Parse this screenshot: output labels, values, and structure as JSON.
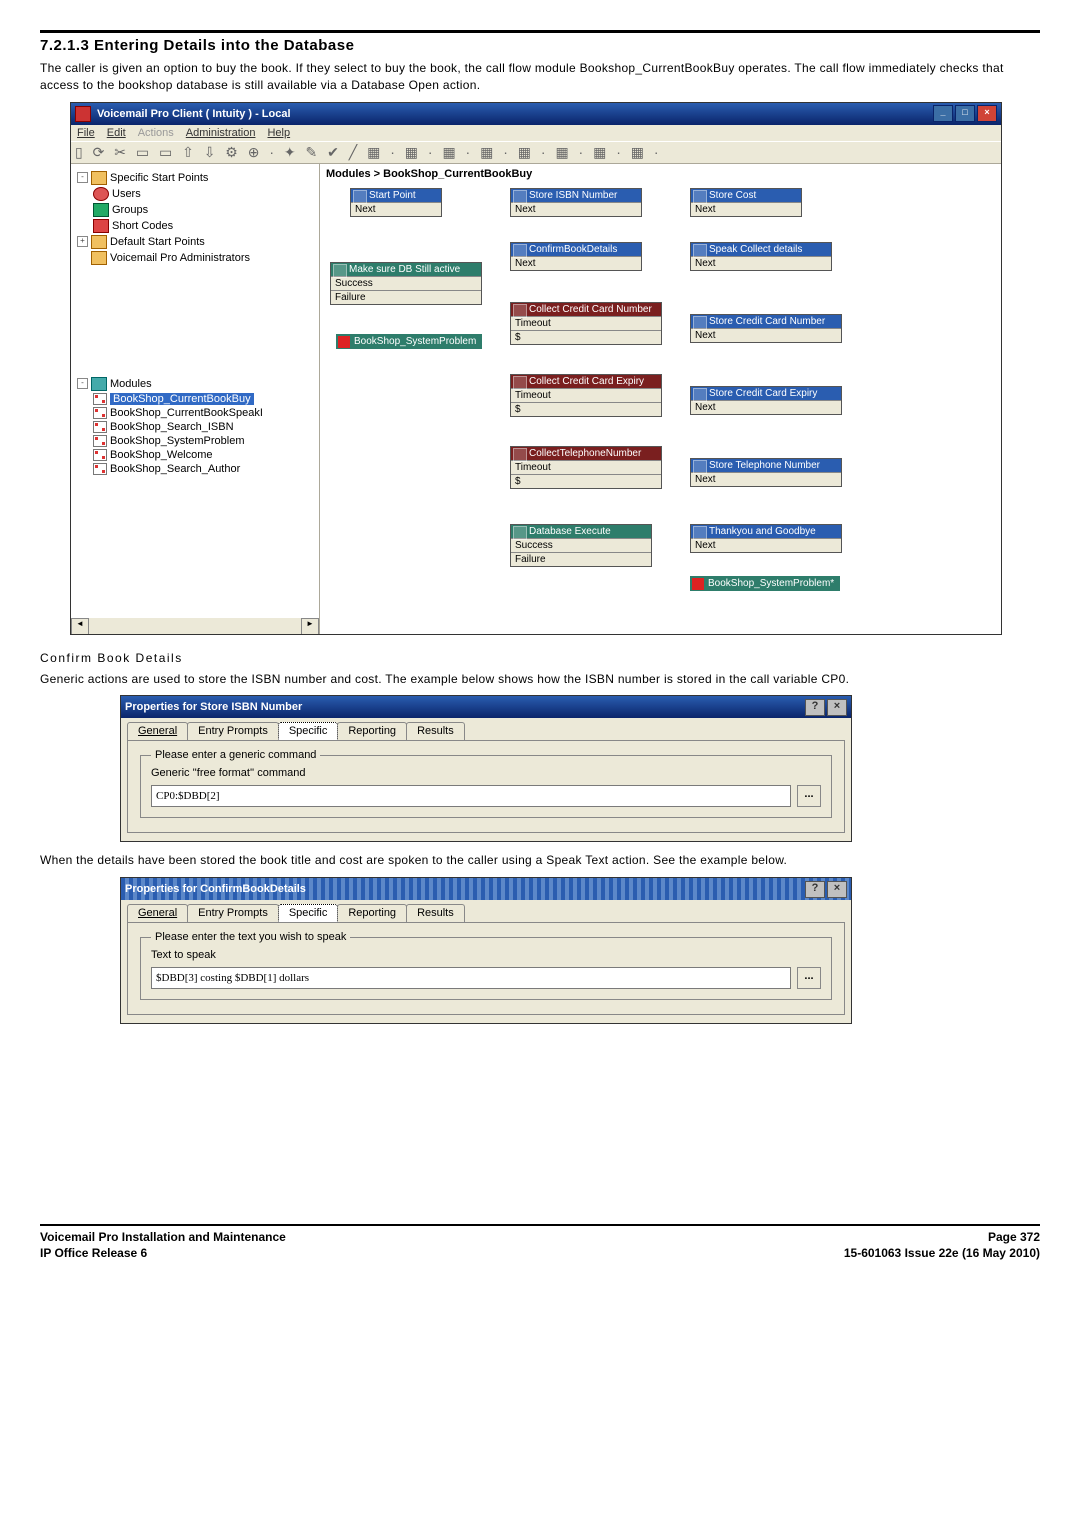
{
  "section": {
    "number_title": "7.2.1.3 Entering Details into the Database",
    "para1": "The caller is given an option to buy the book. If they select to buy the book, the call flow module Bookshop_CurrentBookBuy operates. The call flow immediately checks that access to the bookshop database is still available via a Database Open action.",
    "confirm_title": "Confirm Book Details",
    "para2": "Generic actions are used to store the ISBN number and cost. The example below shows how the ISBN number is stored in the call variable CP0.",
    "para3": "When the details have been stored the book title and cost are spoken to the caller using a Speak Text action. See the example below."
  },
  "app_window": {
    "title": "Voicemail Pro Client    ( Intuity ) -   Local",
    "menus": [
      "File",
      "Edit",
      "Actions",
      "Administration",
      "Help"
    ],
    "breadcrumb": "Modules > BookShop_CurrentBookBuy",
    "tree": {
      "root1": "Specific Start Points",
      "root1_children": [
        "Users",
        "Groups",
        "Short Codes"
      ],
      "root2": "Default Start Points",
      "root3": "Voicemail Pro Administrators",
      "mod_root": "Modules",
      "modules": [
        "BookShop_CurrentBookBuy",
        "BookShop_CurrentBookSpeakI",
        "BookShop_Search_ISBN",
        "BookShop_SystemProblem",
        "BookShop_Welcome",
        "BookShop_Search_Author"
      ]
    },
    "nodes": {
      "start": {
        "title": "Start Point",
        "sub": "Next"
      },
      "db_active": {
        "title": "Make sure DB Still active",
        "sub1": "Success",
        "sub2": "Failure"
      },
      "goto1": "BookShop_SystemProblem",
      "store_isbn": {
        "title": "Store ISBN Number",
        "sub": "Next"
      },
      "confirm": {
        "title": "ConfirmBookDetails",
        "sub": "Next"
      },
      "collect_cc_num": {
        "title": "Collect Credit Card Number",
        "sub1": "Timeout",
        "sub2": "$"
      },
      "collect_cc_exp": {
        "title": "Collect Credit Card Expiry",
        "sub1": "Timeout",
        "sub2": "$"
      },
      "collect_tel": {
        "title": "CollectTelephoneNumber",
        "sub1": "Timeout",
        "sub2": "$"
      },
      "db_exec": {
        "title": "Database Execute",
        "sub1": "Success",
        "sub2": "Failure"
      },
      "store_cost": {
        "title": "Store Cost",
        "sub": "Next"
      },
      "speak_collect": {
        "title": "Speak Collect details",
        "sub": "Next"
      },
      "store_cc_num": {
        "title": "Store Credit Card Number",
        "sub": "Next"
      },
      "store_cc_exp": {
        "title": "Store Credit Card Expiry",
        "sub": "Next"
      },
      "store_tel": {
        "title": "Store Telephone Number",
        "sub": "Next"
      },
      "thanks": {
        "title": "Thankyou and Goodbye",
        "sub": "Next"
      },
      "goto2": "BookShop_SystemProblem*"
    }
  },
  "dialog1": {
    "title": "Properties for Store ISBN Number",
    "tabs": [
      "General",
      "Entry Prompts",
      "Specific",
      "Reporting",
      "Results"
    ],
    "active_tab": "Specific",
    "group": "Please enter a generic command",
    "label": "Generic ''free format'' command",
    "value": "CP0:$DBD[2]",
    "help": "?",
    "close": "×",
    "dots": "..."
  },
  "dialog2": {
    "title": "Properties for ConfirmBookDetails",
    "tabs": [
      "General",
      "Entry Prompts",
      "Specific",
      "Reporting",
      "Results"
    ],
    "active_tab": "Specific",
    "group": "Please enter the text you wish to speak",
    "label": "Text to speak",
    "value": "$DBD[3] costing $DBD[1] dollars",
    "help": "?",
    "close": "×",
    "dots": "..."
  },
  "footer": {
    "left1": "Voicemail Pro Installation and Maintenance",
    "left2": "IP Office Release 6",
    "right1": "Page 372",
    "right2": "15-601063 Issue 22e (16 May 2010)"
  },
  "win_controls": {
    "min": "_",
    "max": "□",
    "close": "×"
  },
  "toolbar_glyphs": "▯ ⟳  ✂ ▭ ▭   ⇧ ⇩ ⚙    ⊕ · ✦ ✎ ✔    ╱   ▦ · ▦ · ▦ · ▦ · ▦ · ▦ · ▦ · ▦ ·"
}
